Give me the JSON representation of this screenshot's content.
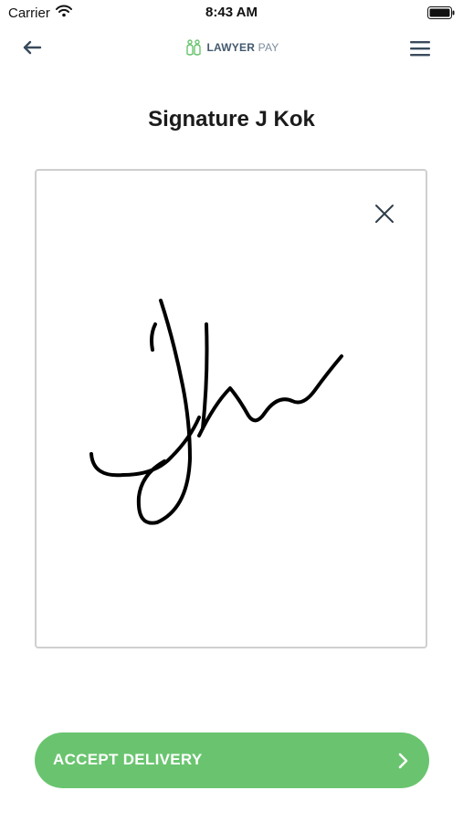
{
  "status_bar": {
    "carrier": "Carrier",
    "time": "8:43 AM",
    "wifi_icon": "wifi-icon",
    "battery_icon": "battery-icon"
  },
  "nav": {
    "back_icon": "arrow-left-icon",
    "menu_icon": "hamburger-menu-icon",
    "logo_strong": "LAWYER",
    "logo_light": "PAY"
  },
  "title": "Signature J Kok",
  "signature_pad": {
    "clear_icon": "close-icon"
  },
  "accept_button": {
    "label": "ACCEPT DELIVERY",
    "icon": "chevron-right-icon"
  },
  "colors": {
    "accent_green": "#6ac46f",
    "logo_green": "#6ac46f",
    "logo_text": "#44596e",
    "pad_border": "#cfcfcf"
  }
}
